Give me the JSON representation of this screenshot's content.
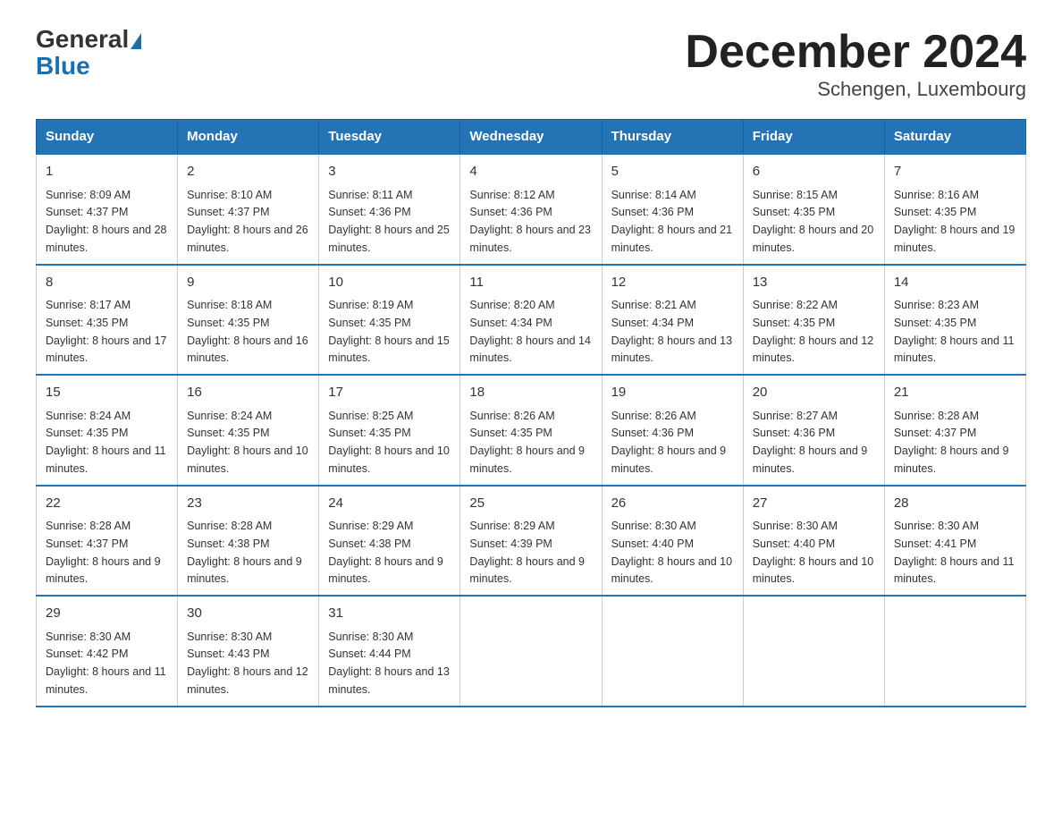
{
  "logo": {
    "line1": "General",
    "line2": "Blue"
  },
  "title": "December 2024",
  "subtitle": "Schengen, Luxembourg",
  "days_of_week": [
    "Sunday",
    "Monday",
    "Tuesday",
    "Wednesday",
    "Thursday",
    "Friday",
    "Saturday"
  ],
  "weeks": [
    [
      {
        "day": "1",
        "sunrise": "8:09 AM",
        "sunset": "4:37 PM",
        "daylight": "8 hours and 28 minutes."
      },
      {
        "day": "2",
        "sunrise": "8:10 AM",
        "sunset": "4:37 PM",
        "daylight": "8 hours and 26 minutes."
      },
      {
        "day": "3",
        "sunrise": "8:11 AM",
        "sunset": "4:36 PM",
        "daylight": "8 hours and 25 minutes."
      },
      {
        "day": "4",
        "sunrise": "8:12 AM",
        "sunset": "4:36 PM",
        "daylight": "8 hours and 23 minutes."
      },
      {
        "day": "5",
        "sunrise": "8:14 AM",
        "sunset": "4:36 PM",
        "daylight": "8 hours and 21 minutes."
      },
      {
        "day": "6",
        "sunrise": "8:15 AM",
        "sunset": "4:35 PM",
        "daylight": "8 hours and 20 minutes."
      },
      {
        "day": "7",
        "sunrise": "8:16 AM",
        "sunset": "4:35 PM",
        "daylight": "8 hours and 19 minutes."
      }
    ],
    [
      {
        "day": "8",
        "sunrise": "8:17 AM",
        "sunset": "4:35 PM",
        "daylight": "8 hours and 17 minutes."
      },
      {
        "day": "9",
        "sunrise": "8:18 AM",
        "sunset": "4:35 PM",
        "daylight": "8 hours and 16 minutes."
      },
      {
        "day": "10",
        "sunrise": "8:19 AM",
        "sunset": "4:35 PM",
        "daylight": "8 hours and 15 minutes."
      },
      {
        "day": "11",
        "sunrise": "8:20 AM",
        "sunset": "4:34 PM",
        "daylight": "8 hours and 14 minutes."
      },
      {
        "day": "12",
        "sunrise": "8:21 AM",
        "sunset": "4:34 PM",
        "daylight": "8 hours and 13 minutes."
      },
      {
        "day": "13",
        "sunrise": "8:22 AM",
        "sunset": "4:35 PM",
        "daylight": "8 hours and 12 minutes."
      },
      {
        "day": "14",
        "sunrise": "8:23 AM",
        "sunset": "4:35 PM",
        "daylight": "8 hours and 11 minutes."
      }
    ],
    [
      {
        "day": "15",
        "sunrise": "8:24 AM",
        "sunset": "4:35 PM",
        "daylight": "8 hours and 11 minutes."
      },
      {
        "day": "16",
        "sunrise": "8:24 AM",
        "sunset": "4:35 PM",
        "daylight": "8 hours and 10 minutes."
      },
      {
        "day": "17",
        "sunrise": "8:25 AM",
        "sunset": "4:35 PM",
        "daylight": "8 hours and 10 minutes."
      },
      {
        "day": "18",
        "sunrise": "8:26 AM",
        "sunset": "4:35 PM",
        "daylight": "8 hours and 9 minutes."
      },
      {
        "day": "19",
        "sunrise": "8:26 AM",
        "sunset": "4:36 PM",
        "daylight": "8 hours and 9 minutes."
      },
      {
        "day": "20",
        "sunrise": "8:27 AM",
        "sunset": "4:36 PM",
        "daylight": "8 hours and 9 minutes."
      },
      {
        "day": "21",
        "sunrise": "8:28 AM",
        "sunset": "4:37 PM",
        "daylight": "8 hours and 9 minutes."
      }
    ],
    [
      {
        "day": "22",
        "sunrise": "8:28 AM",
        "sunset": "4:37 PM",
        "daylight": "8 hours and 9 minutes."
      },
      {
        "day": "23",
        "sunrise": "8:28 AM",
        "sunset": "4:38 PM",
        "daylight": "8 hours and 9 minutes."
      },
      {
        "day": "24",
        "sunrise": "8:29 AM",
        "sunset": "4:38 PM",
        "daylight": "8 hours and 9 minutes."
      },
      {
        "day": "25",
        "sunrise": "8:29 AM",
        "sunset": "4:39 PM",
        "daylight": "8 hours and 9 minutes."
      },
      {
        "day": "26",
        "sunrise": "8:30 AM",
        "sunset": "4:40 PM",
        "daylight": "8 hours and 10 minutes."
      },
      {
        "day": "27",
        "sunrise": "8:30 AM",
        "sunset": "4:40 PM",
        "daylight": "8 hours and 10 minutes."
      },
      {
        "day": "28",
        "sunrise": "8:30 AM",
        "sunset": "4:41 PM",
        "daylight": "8 hours and 11 minutes."
      }
    ],
    [
      {
        "day": "29",
        "sunrise": "8:30 AM",
        "sunset": "4:42 PM",
        "daylight": "8 hours and 11 minutes."
      },
      {
        "day": "30",
        "sunrise": "8:30 AM",
        "sunset": "4:43 PM",
        "daylight": "8 hours and 12 minutes."
      },
      {
        "day": "31",
        "sunrise": "8:30 AM",
        "sunset": "4:44 PM",
        "daylight": "8 hours and 13 minutes."
      },
      null,
      null,
      null,
      null
    ]
  ]
}
